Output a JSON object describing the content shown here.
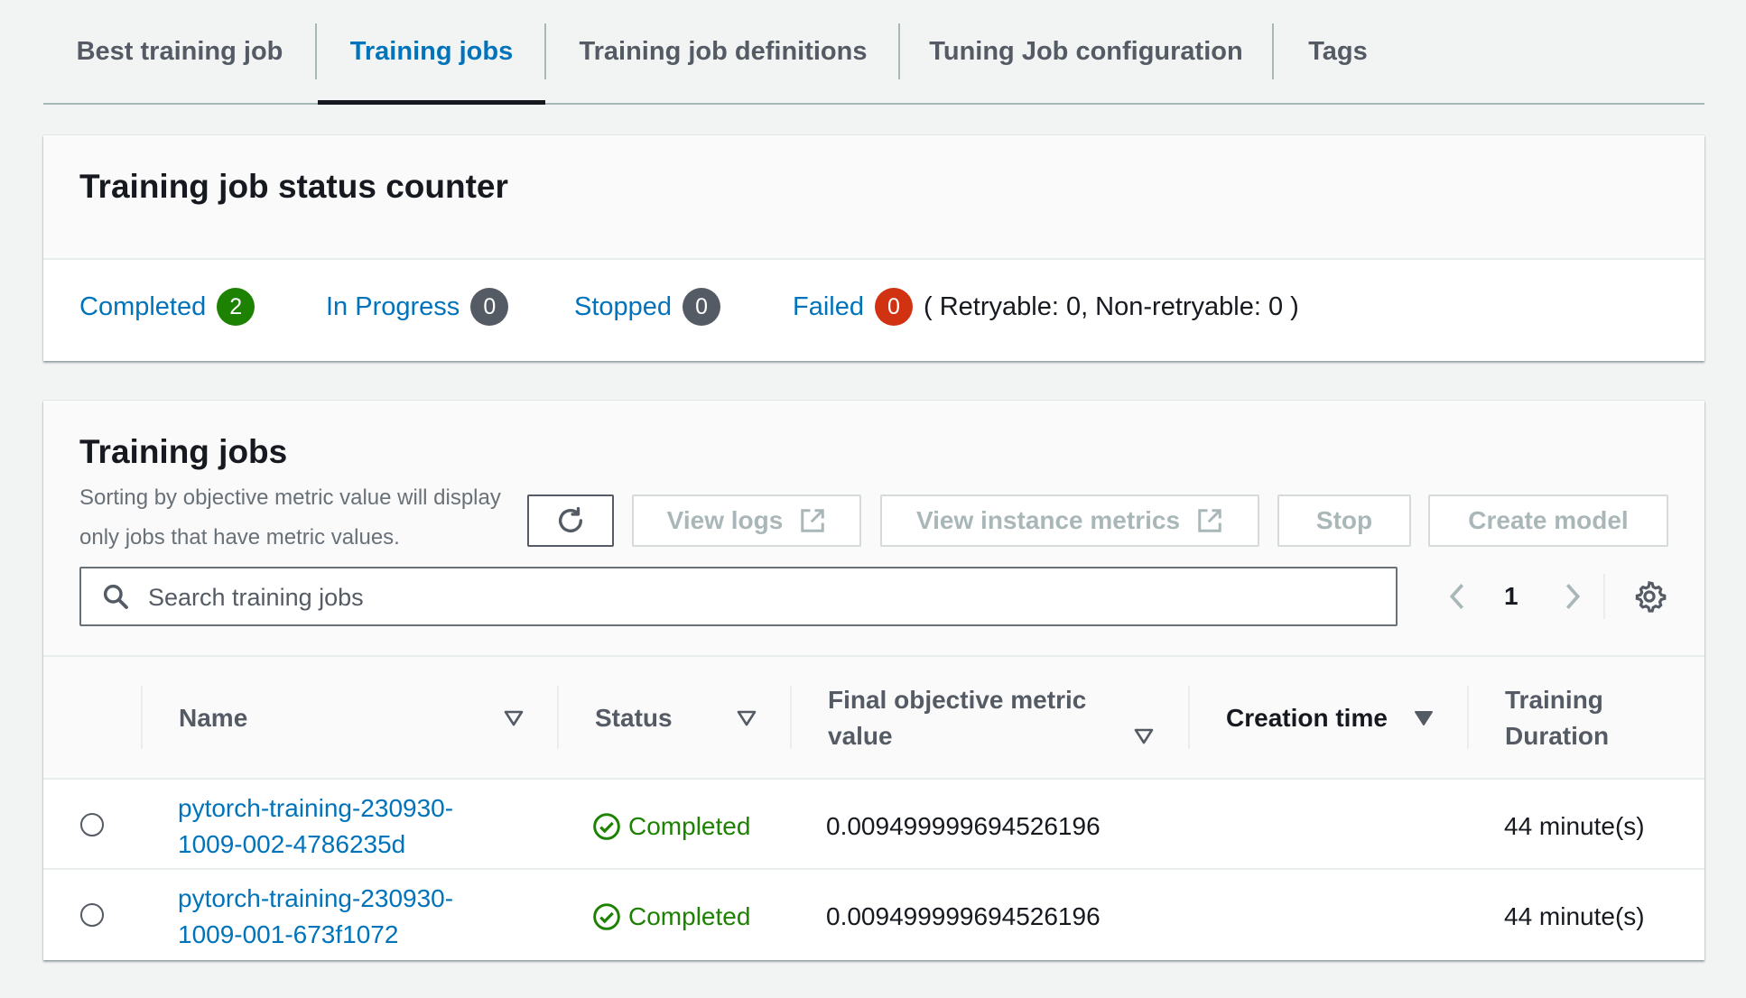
{
  "tabs": [
    {
      "label": "Best training job"
    },
    {
      "label": "Training jobs"
    },
    {
      "label": "Training job definitions"
    },
    {
      "label": "Tuning Job configuration"
    },
    {
      "label": "Tags"
    }
  ],
  "status_counter": {
    "title": "Training job status counter",
    "completed_label": "Completed",
    "completed_count": "2",
    "in_progress_label": "In Progress",
    "in_progress_count": "0",
    "stopped_label": "Stopped",
    "stopped_count": "0",
    "failed_label": "Failed",
    "failed_count": "0",
    "retry_note": "( Retryable: 0, Non-retryable: 0 )",
    "colors": {
      "completed": "#1d8102",
      "neutral": "#545b64",
      "failed": "#d13212"
    }
  },
  "training_jobs": {
    "title": "Training jobs",
    "description_line1": "Sorting by objective metric value will display",
    "description_line2": "only jobs that have metric values.",
    "buttons": {
      "refresh_icon": "refresh-icon",
      "view_logs": "View logs",
      "view_instance_metrics": "View instance metrics",
      "stop": "Stop",
      "create_model": "Create model"
    },
    "search": {
      "placeholder": "Search training jobs",
      "value": ""
    },
    "pagination": {
      "current_page": "1"
    },
    "columns": {
      "name": "Name",
      "status": "Status",
      "metric_line1": "Final objective metric",
      "metric_line2": "value",
      "creation_time": "Creation time",
      "duration_line1": "Training",
      "duration_line2": "Duration"
    },
    "rows": [
      {
        "name_line1": "pytorch-training-230930-",
        "name_line2": "1009-002-4786235d",
        "status": "Completed",
        "metric": "0.009499999694526196",
        "creation_time": "",
        "duration": "44 minute(s)"
      },
      {
        "name_line1": "pytorch-training-230930-",
        "name_line2": "1009-001-673f1072",
        "status": "Completed",
        "metric": "0.009499999694526196",
        "creation_time": "",
        "duration": "44 minute(s)"
      }
    ]
  }
}
